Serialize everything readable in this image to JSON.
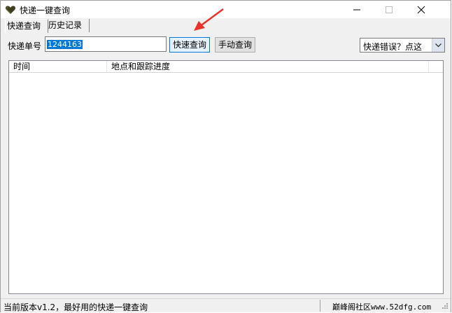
{
  "window": {
    "title": "快递一键查询",
    "icon": "heart-icon"
  },
  "tabs": [
    {
      "label": "快递查询",
      "active": true
    },
    {
      "label": "历史记录",
      "active": false
    }
  ],
  "search": {
    "label": "快递单号",
    "value": "1244163",
    "quick_button": "快速查询",
    "manual_button": "手动查询"
  },
  "error_combo": {
    "selected": "快递错误？点这"
  },
  "table": {
    "columns": [
      "时间",
      "地点和跟踪进度",
      ""
    ],
    "rows": []
  },
  "statusbar": {
    "left": "当前版本v1.2，最好用的快递一键查询",
    "right": "巅峰阁社区www.52dfg.com"
  },
  "colors": {
    "selection": "#0078d7",
    "annotation_arrow": "#e8322a"
  }
}
